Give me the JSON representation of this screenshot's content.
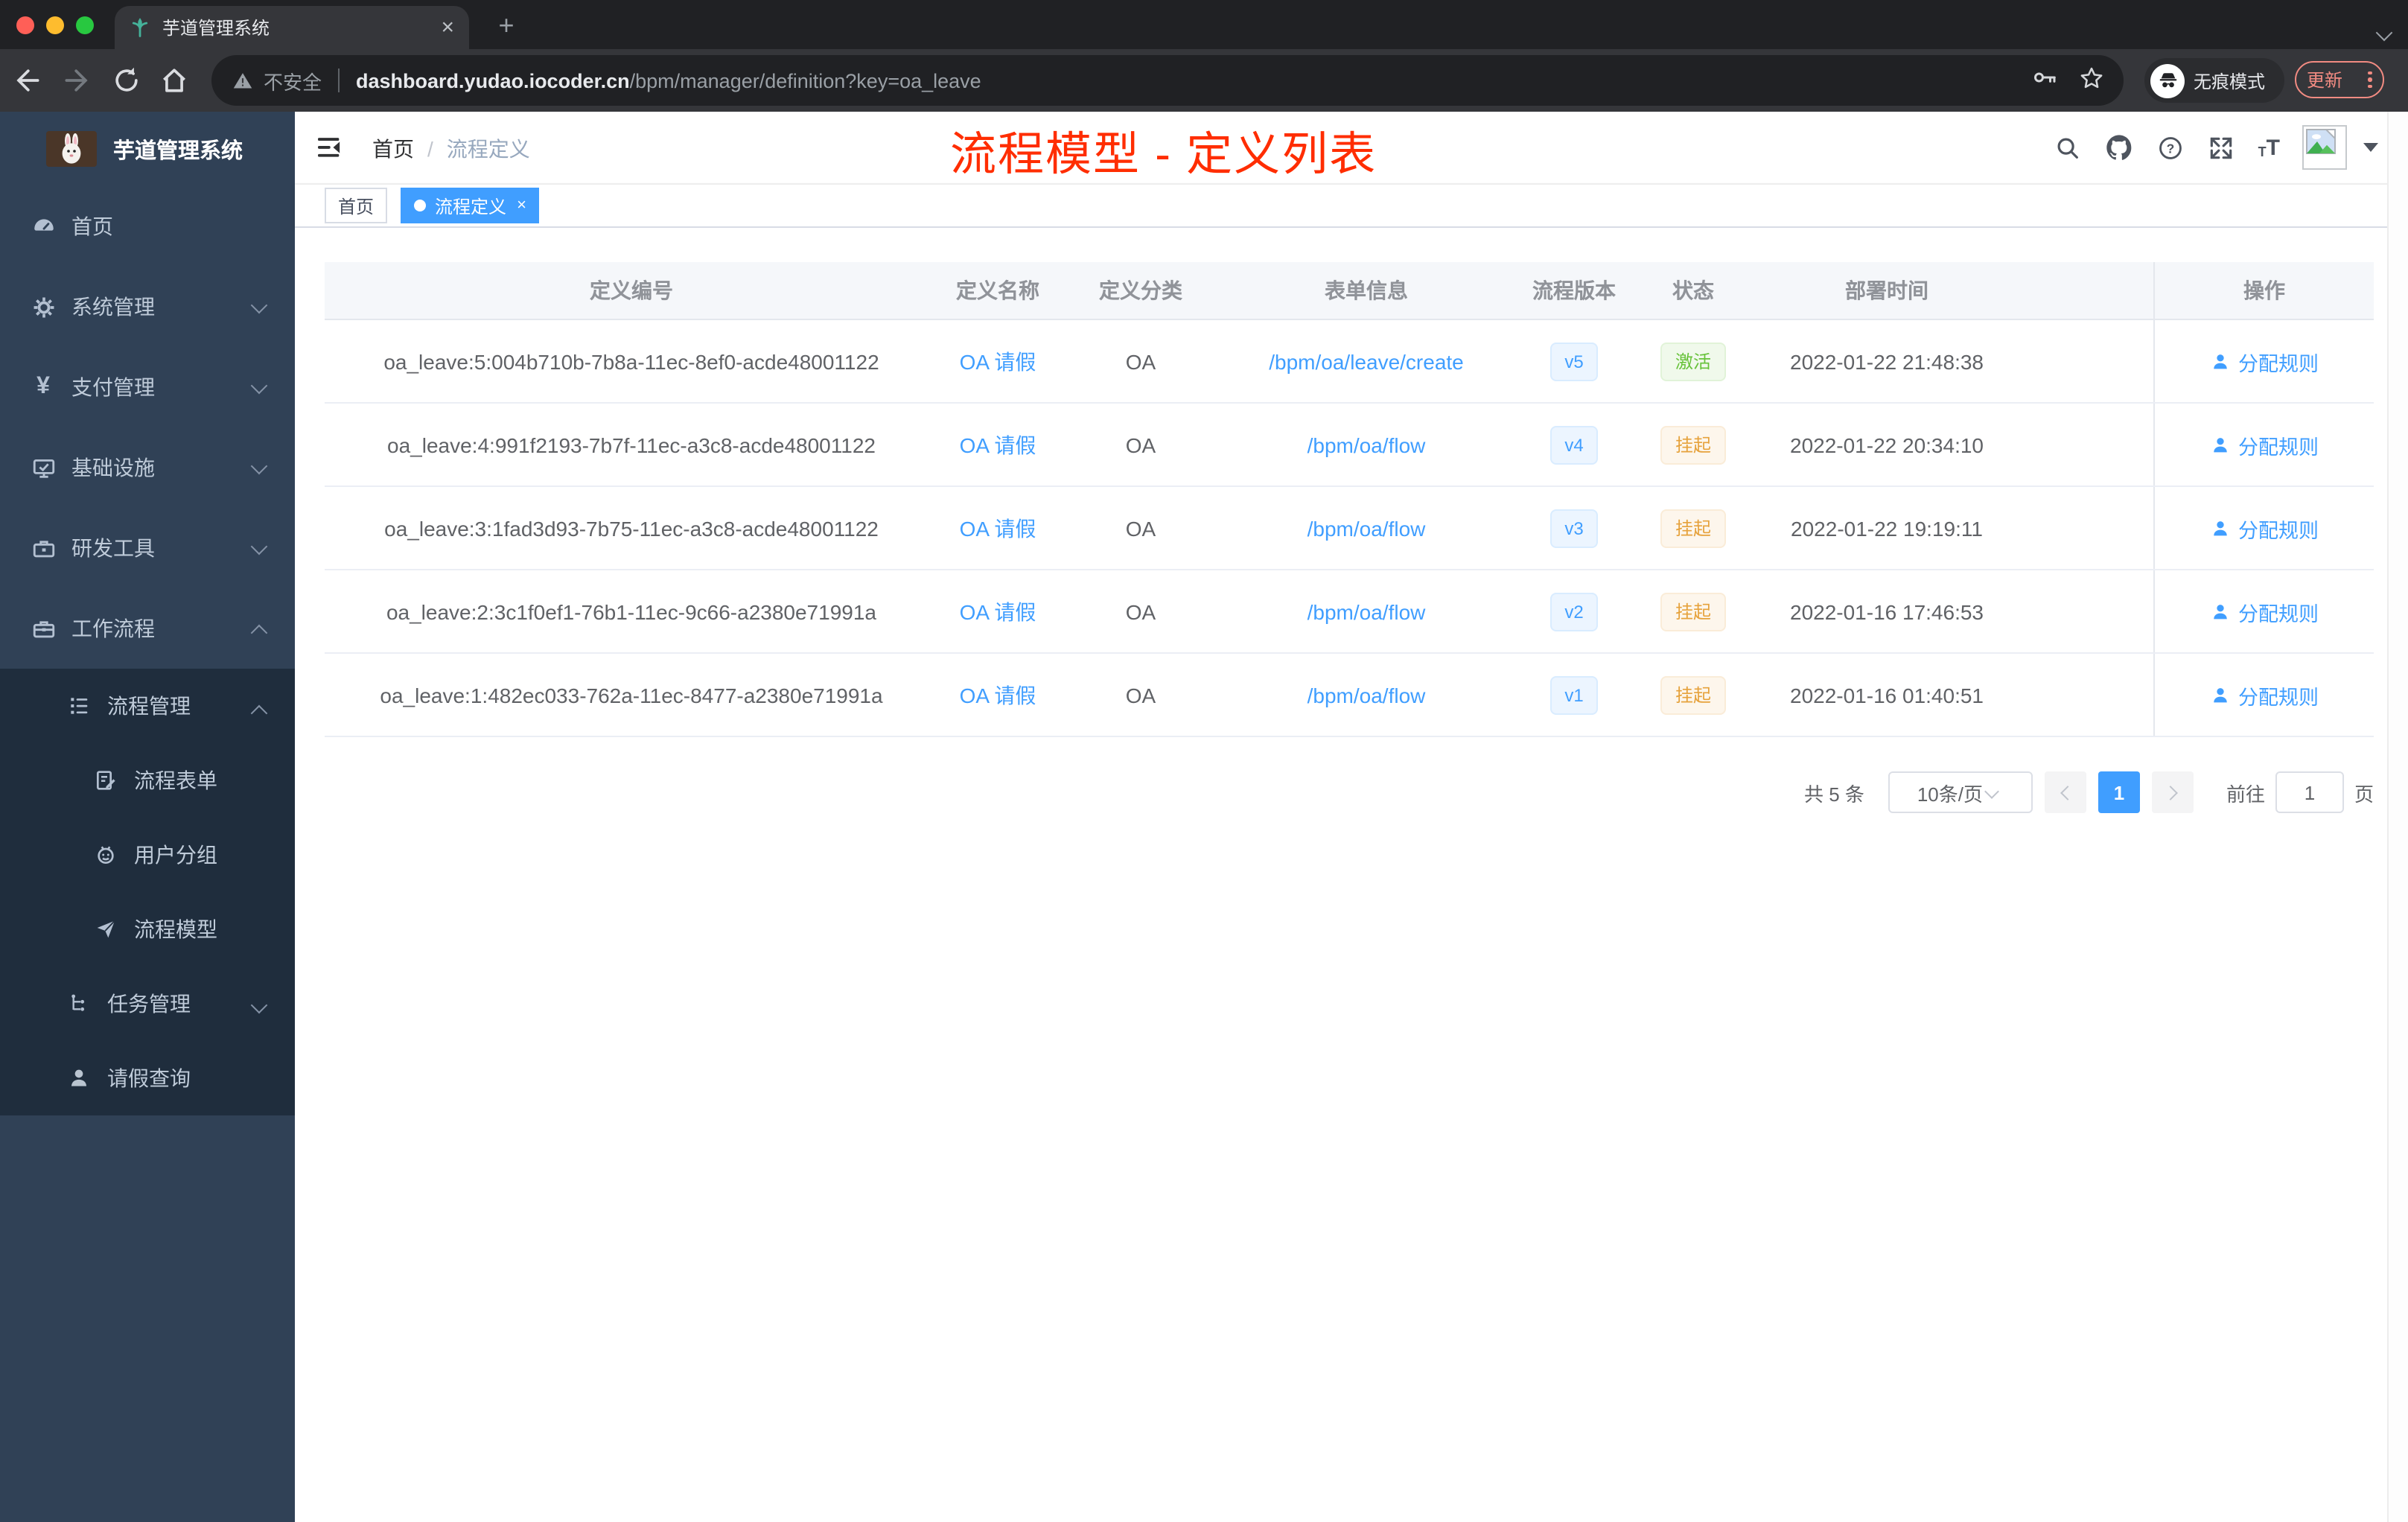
{
  "colors": {
    "accent": "#409eff",
    "success": "#67c23a",
    "warning": "#e6a23c",
    "annotation_red": "#ff2d00",
    "sidebar_bg": "#304156",
    "submenu_bg": "#1f2d3d",
    "active_tag_bg": "#409eff"
  },
  "browser": {
    "tab_title": "芋道管理系统",
    "tab_close_glyph": "×",
    "new_tab_glyph": "+",
    "security_label": "不安全",
    "url_host": "dashboard.yudao.iocoder.cn",
    "url_path": "/bpm/manager/definition?key=oa_leave",
    "incognito_label": "无痕模式",
    "update_label": "更新"
  },
  "sidebar": {
    "logo_title": "芋道管理系统",
    "menu": [
      {
        "label": "首页",
        "icon": "dashboard-icon"
      },
      {
        "label": "系统管理",
        "icon": "gear-icon",
        "state": "collapsed"
      },
      {
        "label": "支付管理",
        "icon": "yen-icon",
        "state": "collapsed"
      },
      {
        "label": "基础设施",
        "icon": "monitor-icon",
        "state": "collapsed"
      },
      {
        "label": "研发工具",
        "icon": "toolbox-icon",
        "state": "collapsed"
      },
      {
        "label": "工作流程",
        "icon": "briefcase-icon",
        "state": "expanded"
      }
    ],
    "submenu": [
      {
        "label": "流程管理",
        "icon": "flow-list-icon",
        "state": "expanded"
      },
      {
        "label": "流程表单",
        "icon": "form-icon"
      },
      {
        "label": "用户分组",
        "icon": "robot-icon"
      },
      {
        "label": "流程模型",
        "icon": "paper-plane-icon"
      },
      {
        "label": "任务管理",
        "icon": "tree-icon",
        "state": "collapsed"
      },
      {
        "label": "请假查询",
        "icon": "user-icon"
      }
    ]
  },
  "header": {
    "breadcrumb": {
      "home": "首页",
      "separator": "/",
      "current": "流程定义"
    },
    "annotation": "流程模型 - 定义列表"
  },
  "tags": [
    {
      "label": "首页",
      "active": false
    },
    {
      "label": "流程定义",
      "active": true,
      "close_glyph": "×"
    }
  ],
  "table": {
    "columns": [
      "定义编号",
      "定义名称",
      "定义分类",
      "表单信息",
      "流程版本",
      "状态",
      "部署时间",
      "操作"
    ],
    "rows": [
      {
        "id": "oa_leave:5:004b710b-7b8a-11ec-8ef0-acde48001122",
        "name": "OA 请假",
        "category": "OA",
        "form": "/bpm/oa/leave/create",
        "version": "v5",
        "status": "激活",
        "status_type": "active",
        "deployed": "2022-01-22 21:48:38",
        "action": "分配规则"
      },
      {
        "id": "oa_leave:4:991f2193-7b7f-11ec-a3c8-acde48001122",
        "name": "OA 请假",
        "category": "OA",
        "form": "/bpm/oa/flow",
        "version": "v4",
        "status": "挂起",
        "status_type": "suspended",
        "deployed": "2022-01-22 20:34:10",
        "action": "分配规则"
      },
      {
        "id": "oa_leave:3:1fad3d93-7b75-11ec-a3c8-acde48001122",
        "name": "OA 请假",
        "category": "OA",
        "form": "/bpm/oa/flow",
        "version": "v3",
        "status": "挂起",
        "status_type": "suspended",
        "deployed": "2022-01-22 19:19:11",
        "action": "分配规则"
      },
      {
        "id": "oa_leave:2:3c1f0ef1-76b1-11ec-9c66-a2380e71991a",
        "name": "OA 请假",
        "category": "OA",
        "form": "/bpm/oa/flow",
        "version": "v2",
        "status": "挂起",
        "status_type": "suspended",
        "deployed": "2022-01-16 17:46:53",
        "action": "分配规则"
      },
      {
        "id": "oa_leave:1:482ec033-762a-11ec-8477-a2380e71991a",
        "name": "OA 请假",
        "category": "OA",
        "form": "/bpm/oa/flow",
        "version": "v1",
        "status": "挂起",
        "status_type": "suspended",
        "deployed": "2022-01-16 01:40:51",
        "action": "分配规则"
      }
    ]
  },
  "pagination": {
    "total": "共 5 条",
    "page_size": "10条/页",
    "current_page": "1",
    "goto_label": "前往",
    "goto_value": "1",
    "page_unit": "页"
  }
}
